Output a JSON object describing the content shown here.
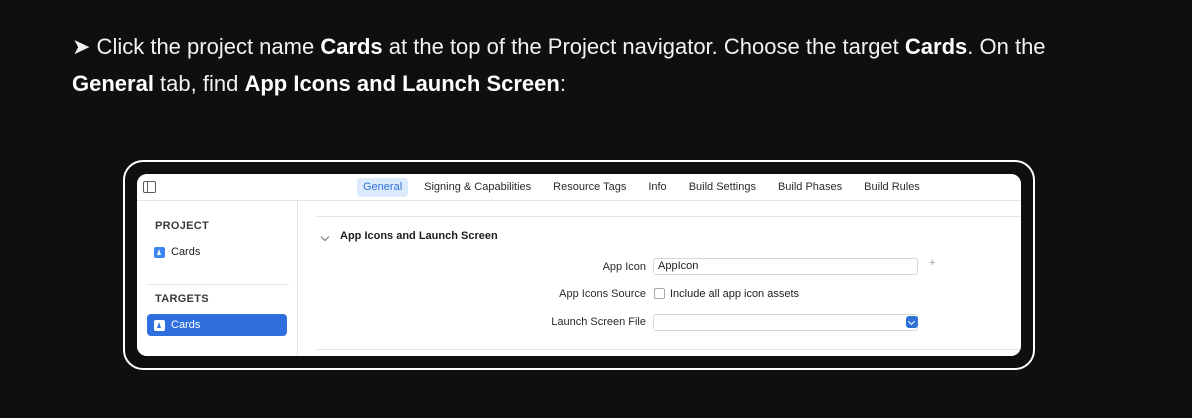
{
  "instruction": {
    "bullet": "➤",
    "part1": " Click the project name ",
    "bold1": "Cards",
    "part2": " at the top of the Project navigator. Choose the target ",
    "bold2": "Cards",
    "part3": ". On the ",
    "bold3": "General",
    "part4": " tab, find ",
    "bold4": "App Icons and Launch Screen",
    "part5": ":"
  },
  "toolbar": {
    "sidebar_toggle_icon": "sidebar-toggle-icon",
    "tabs": [
      {
        "label": "General",
        "active": true
      },
      {
        "label": "Signing & Capabilities"
      },
      {
        "label": "Resource Tags"
      },
      {
        "label": "Info"
      },
      {
        "label": "Build Settings"
      },
      {
        "label": "Build Phases"
      },
      {
        "label": "Build Rules"
      }
    ]
  },
  "sidebar": {
    "project_header": "PROJECT",
    "project_item": "Cards",
    "targets_header": "TARGETS",
    "target_item": "Cards"
  },
  "main": {
    "section_title": "App Icons and Launch Screen",
    "app_icon_label": "App Icon",
    "app_icon_value": "AppIcon",
    "add_button": "+",
    "app_icons_source_label": "App Icons Source",
    "include_all_label": "Include all app icon assets",
    "include_all_checked": false,
    "launch_screen_label": "Launch Screen File",
    "launch_screen_value": ""
  },
  "colors": {
    "background": "#0f0f12",
    "accent": "#2f6fde",
    "active_tab_bg": "#dcebfc"
  }
}
